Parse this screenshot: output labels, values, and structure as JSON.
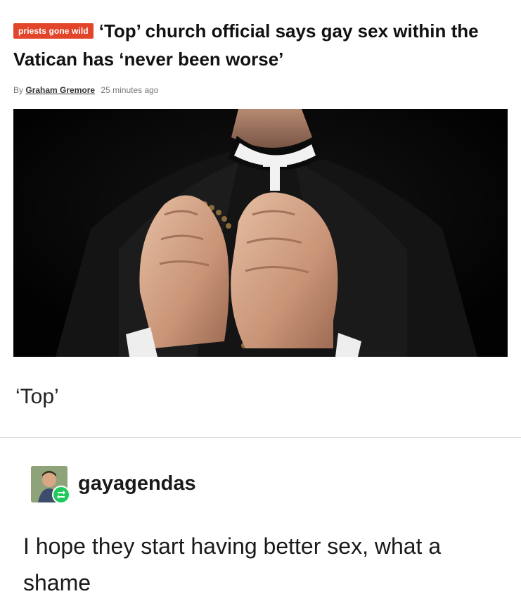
{
  "article": {
    "tag": "priests gone wild",
    "headline": "‘Top’ church official says gay sex within the Vatican has ‘never been worse’",
    "byline_prefix": "By",
    "author": "Graham Gremore",
    "time": "25 minutes ago"
  },
  "caption": "‘Top’",
  "reblog": {
    "username": "gayagendas",
    "comment": "I hope they start having better sex, what a shame"
  },
  "colors": {
    "tag_bg": "#e3452b",
    "reblog_green": "#1fc95c",
    "photo_bg": "#050505"
  },
  "icons": {
    "reblog_badge": "reblog-icon"
  }
}
